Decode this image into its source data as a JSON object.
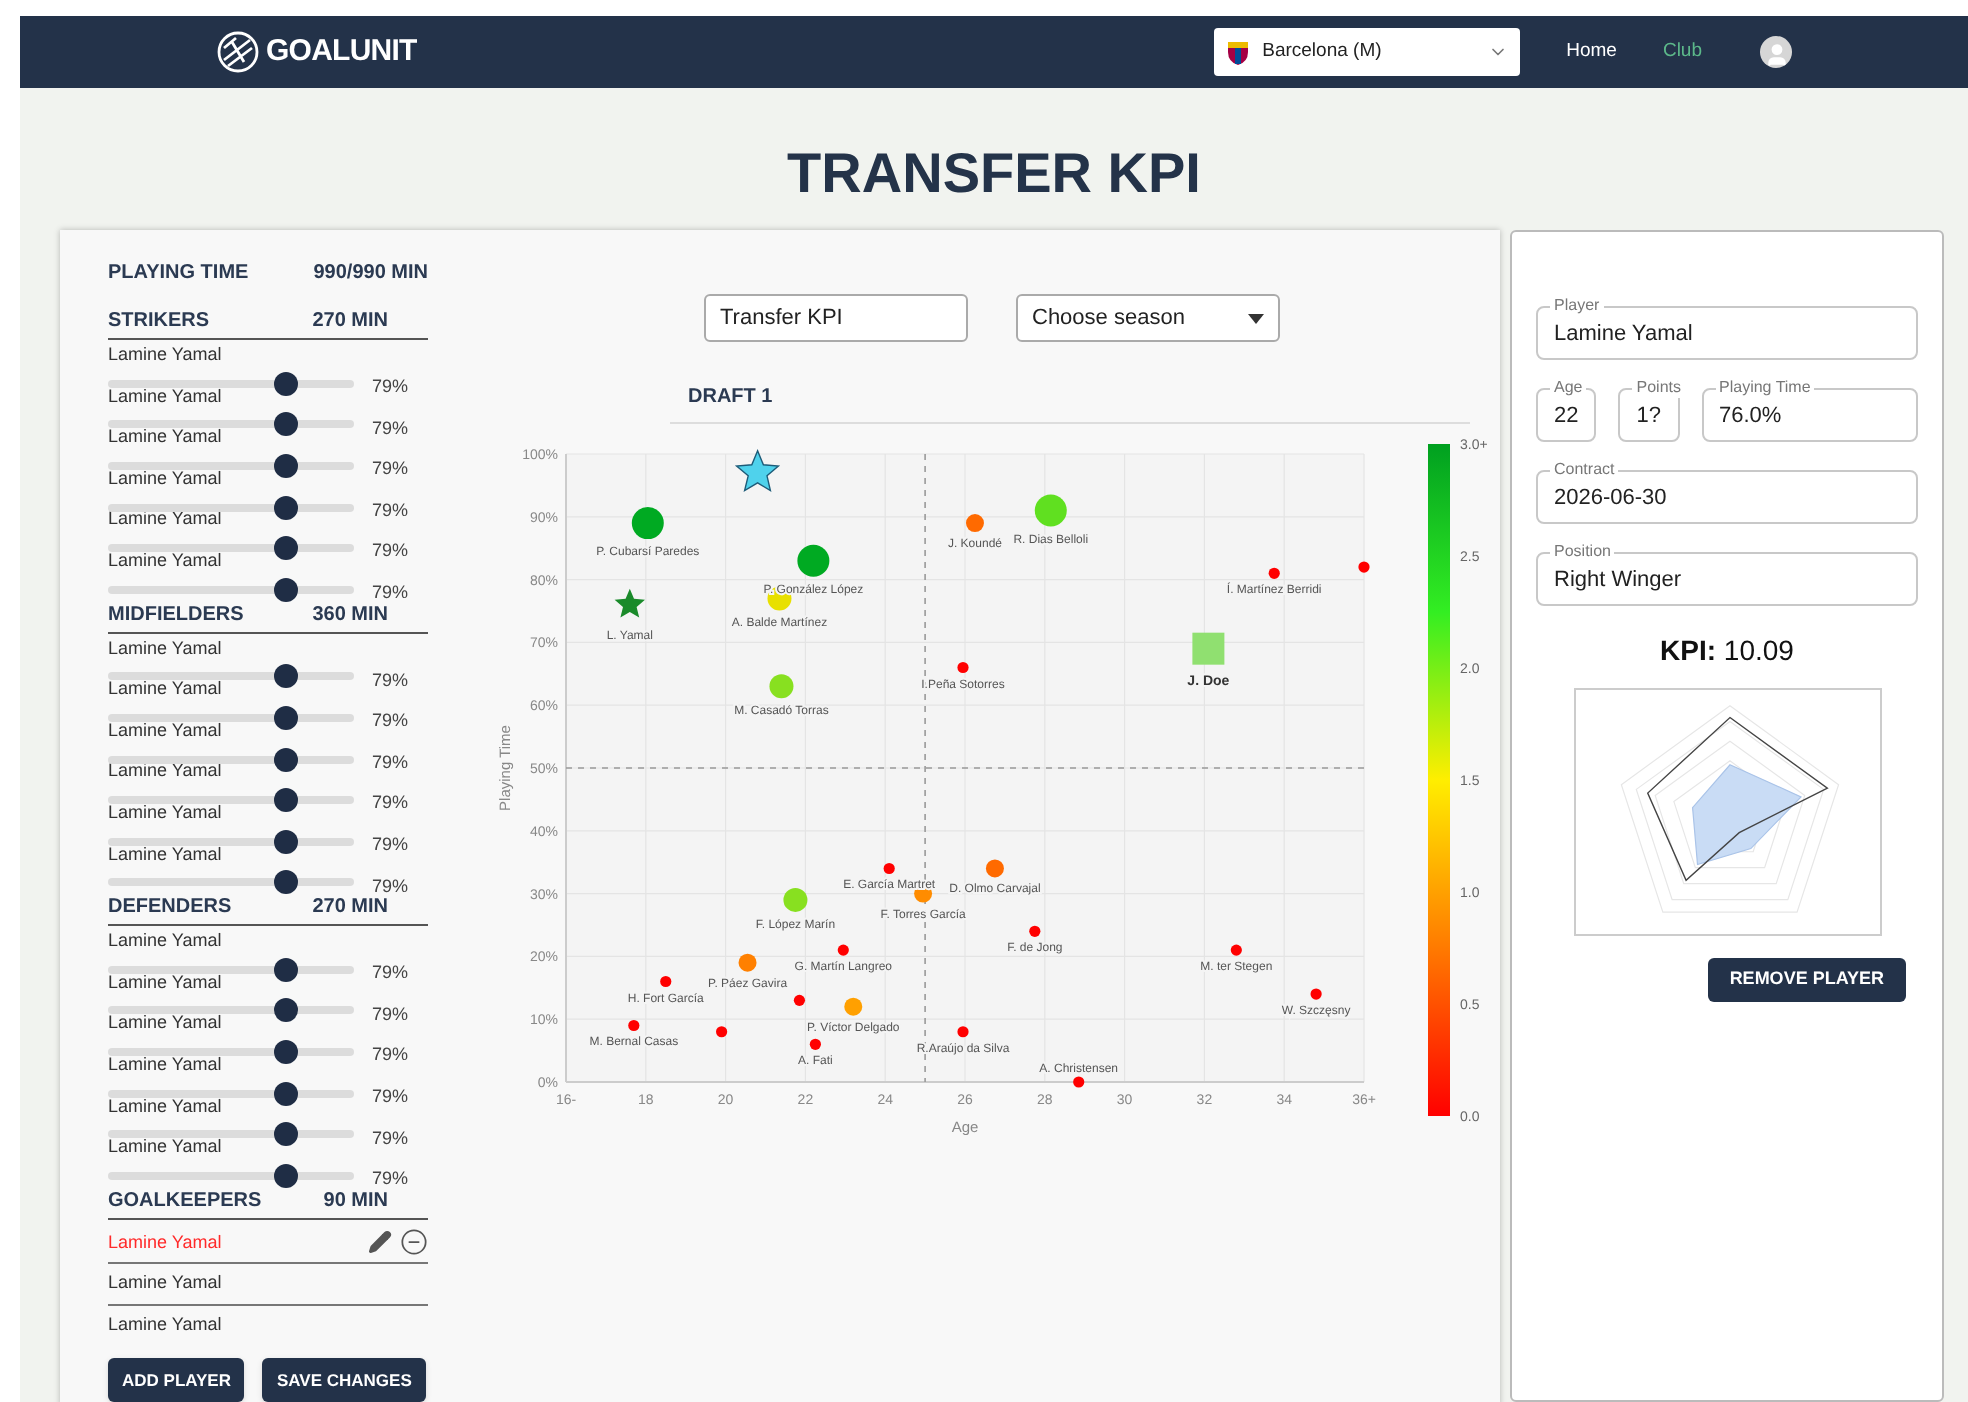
{
  "nav": {
    "logo": "GOALUNIT",
    "team_select": {
      "value": "Barcelona (M)"
    },
    "links": [
      {
        "label": "Home",
        "selected": false
      },
      {
        "label": "Club",
        "selected": true
      }
    ]
  },
  "page_title": "TRANSFER KPI",
  "squad": {
    "total": {
      "label": "PLAYING TIME",
      "value": "990/990 MIN"
    },
    "groups": [
      {
        "title": "STRIKERS",
        "minutes": "270 MIN",
        "kind": "slider",
        "players": [
          {
            "name": "Lamine Yamal",
            "level": 0.72,
            "reading": "79%"
          },
          {
            "name": "Lamine Yamal",
            "level": 0.72,
            "reading": "79%"
          },
          {
            "name": "Lamine Yamal",
            "level": 0.72,
            "reading": "79%"
          },
          {
            "name": "Lamine Yamal",
            "level": 0.72,
            "reading": "79%"
          },
          {
            "name": "Lamine Yamal",
            "level": 0.72,
            "reading": "79%"
          },
          {
            "name": "Lamine Yamal",
            "level": 0.72,
            "reading": "79%"
          }
        ]
      },
      {
        "title": "MIDFIELDERS",
        "minutes": "360 MIN",
        "kind": "slider",
        "players": [
          {
            "name": "Lamine Yamal",
            "level": 0.72,
            "reading": "79%"
          },
          {
            "name": "Lamine Yamal",
            "level": 0.72,
            "reading": "79%"
          },
          {
            "name": "Lamine Yamal",
            "level": 0.72,
            "reading": "79%"
          },
          {
            "name": "Lamine Yamal",
            "level": 0.72,
            "reading": "79%"
          },
          {
            "name": "Lamine Yamal",
            "level": 0.72,
            "reading": "79%"
          },
          {
            "name": "Lamine Yamal",
            "level": 0.72,
            "reading": "79%"
          }
        ]
      },
      {
        "title": "DEFENDERS",
        "minutes": "270 MIN",
        "kind": "slider",
        "players": [
          {
            "name": "Lamine Yamal",
            "level": 0.72,
            "reading": "79%"
          },
          {
            "name": "Lamine Yamal",
            "level": 0.72,
            "reading": "79%"
          },
          {
            "name": "Lamine Yamal",
            "level": 0.72,
            "reading": "79%"
          },
          {
            "name": "Lamine Yamal",
            "level": 0.72,
            "reading": "79%"
          },
          {
            "name": "Lamine Yamal",
            "level": 0.72,
            "reading": "79%"
          },
          {
            "name": "Lamine Yamal",
            "level": 0.72,
            "reading": "79%"
          }
        ]
      },
      {
        "title": "GOALKEEPERS",
        "minutes": "90 MIN",
        "kind": "list",
        "players": [
          {
            "name": "Lamine Yamal",
            "selected": true
          },
          {
            "name": "Lamine Yamal",
            "selected": false
          },
          {
            "name": "Lamine Yamal",
            "selected": false
          }
        ]
      }
    ],
    "buttons": [
      "ADD PLAYER",
      "SAVE CHANGES"
    ]
  },
  "controls": {
    "name_field": {
      "value": "Transfer KPI"
    },
    "season_select": {
      "placeholder": "Choose season"
    }
  },
  "draft": {
    "title": "DRAFT 1",
    "chart_data": {
      "type": "scatter",
      "xlabel": "Age",
      "ylabel": "Playing Time",
      "xlim": [
        16,
        36
      ],
      "ylim": [
        0,
        100
      ],
      "xticks": [
        {
          "value": 16,
          "label": "16-"
        },
        {
          "value": 18,
          "label": "18"
        },
        {
          "value": 20,
          "label": "20"
        },
        {
          "value": 22,
          "label": "22"
        },
        {
          "value": 24,
          "label": "24"
        },
        {
          "value": 26,
          "label": "26"
        },
        {
          "value": 28,
          "label": "28"
        },
        {
          "value": 30,
          "label": "30"
        },
        {
          "value": 32,
          "label": "32"
        },
        {
          "value": 34,
          "label": "34"
        },
        {
          "value": 36,
          "label": "36+"
        }
      ],
      "yticks": [
        {
          "value": 0,
          "label": "0%"
        },
        {
          "value": 10,
          "label": "10%"
        },
        {
          "value": 20,
          "label": "20%"
        },
        {
          "value": 30,
          "label": "30%"
        },
        {
          "value": 40,
          "label": "40%"
        },
        {
          "value": 50,
          "label": "50%"
        },
        {
          "value": 60,
          "label": "60%"
        },
        {
          "value": 70,
          "label": "70%"
        },
        {
          "value": 80,
          "label": "80%"
        },
        {
          "value": 90,
          "label": "90%"
        },
        {
          "value": 100,
          "label": "100%"
        }
      ],
      "grid": true,
      "ref_lines": [
        {
          "axis": "x",
          "value": 25
        },
        {
          "axis": "y",
          "value": 50
        }
      ],
      "x": [
        20.8,
        18.05,
        22.2,
        17.6,
        21.35,
        21.4,
        26.25,
        28.15,
        33.75,
        36,
        32.1,
        25.95,
        24.1,
        26.75,
        24.95,
        21.75,
        27.75,
        22.95,
        20.55,
        32.8,
        18.5,
        34.8,
        23.2,
        21.85,
        17.7,
        19.9,
        25.95,
        22.25,
        28.85
      ],
      "series": [
        {
          "values": [
            97,
            89,
            83,
            76,
            77,
            63,
            89,
            91,
            81,
            82,
            69,
            66,
            34,
            34,
            30,
            29,
            24,
            21,
            19,
            21,
            16,
            14,
            12,
            13,
            9,
            8,
            8,
            6,
            0
          ]
        }
      ]
    },
    "points": [
      {
        "kind": "large-star",
        "color": "#4fd2ec"
      },
      {
        "name": "P. Cubarsí Paredes",
        "kind": "large-dot",
        "color": "#00aa22"
      },
      {
        "name": "P. González López",
        "kind": "large-dot",
        "color": "#00aa22"
      },
      {
        "name": "L. Yamal",
        "kind": "star",
        "color": "#1a8a2a"
      },
      {
        "name": "A. Balde Martínez",
        "kind": "medium-dot",
        "color": "#e8e000"
      },
      {
        "name": "M. Casadó Torras",
        "kind": "medium-dot",
        "color": "#88e020"
      },
      {
        "name": "J. Koundé",
        "kind": "small-dot",
        "color": "#ff6a00"
      },
      {
        "name": "R. Dias Belloli",
        "kind": "large-dot",
        "color": "#60e020"
      },
      {
        "name": "Í. Martínez Berridi",
        "kind": "tiny-dot",
        "color": "#ff0000"
      },
      {
        "kind": "tiny-dot",
        "color": "#ff0000"
      },
      {
        "name": "J. Doe",
        "kind": "square",
        "color": "#90e070"
      },
      {
        "name": "I.Peña Sotorres",
        "kind": "tiny-dot",
        "color": "#ff0000"
      },
      {
        "name": "E. García Martret",
        "kind": "tiny-dot",
        "color": "#ff0000"
      },
      {
        "name": "D. Olmo Carvajal",
        "kind": "small-dot",
        "color": "#ff6a00"
      },
      {
        "name": "F. Torres García",
        "kind": "small-dot",
        "color": "#ff8c00"
      },
      {
        "name": "F. López Marín",
        "kind": "medium-dot",
        "color": "#88e020"
      },
      {
        "name": "F. de Jong",
        "kind": "tiny-dot",
        "color": "#ff0000"
      },
      {
        "name": "G. Martín Langreo",
        "kind": "tiny-dot",
        "color": "#ff0000"
      },
      {
        "name": "P. Páez Gavira",
        "kind": "small-dot",
        "color": "#ff8000"
      },
      {
        "name": "M. ter Stegen",
        "kind": "tiny-dot",
        "color": "#ff0000"
      },
      {
        "name": "H. Fort García",
        "kind": "tiny-dot",
        "color": "#ff0000"
      },
      {
        "name": "W. Szczęsny",
        "kind": "tiny-dot",
        "color": "#ff0000"
      },
      {
        "name": "P. Víctor Delgado",
        "kind": "small-dot",
        "color": "#ffa000"
      },
      {
        "kind": "tiny-dot",
        "color": "#ff0000"
      },
      {
        "name": "M. Bernal Casas",
        "kind": "tiny-dot",
        "color": "#ff0000"
      },
      {
        "kind": "tiny-dot",
        "color": "#ff0000"
      },
      {
        "name": "R.Araújo da Silva",
        "kind": "tiny-dot",
        "color": "#ff0000"
      },
      {
        "name": "A. Fati",
        "kind": "tiny-dot",
        "color": "#ff0000"
      },
      {
        "name": "A. Christensen",
        "kind": "tiny-dot",
        "color": "#ff0000"
      }
    ],
    "color_scale": {
      "labels": [
        "3.0+",
        "2.5",
        "2.0",
        "1.5",
        "1.0",
        "0.5",
        "0.0"
      ]
    }
  },
  "player_panel": {
    "field_rows": [
      [
        {
          "label": "Player",
          "value": "Lamine Yamal"
        }
      ],
      [
        {
          "label": "Age",
          "value": "22"
        },
        {
          "label": "Points",
          "value": "1?"
        },
        {
          "label": "Playing Time",
          "value": "76.0%"
        }
      ],
      [
        {
          "label": "Contract",
          "value": "2026-06-30"
        }
      ],
      [
        {
          "label": "Position",
          "value": "Right Winger"
        }
      ]
    ],
    "kpi": {
      "label": "KPI:",
      "value": "10.09"
    },
    "button": "REMOVE PLAYER"
  }
}
